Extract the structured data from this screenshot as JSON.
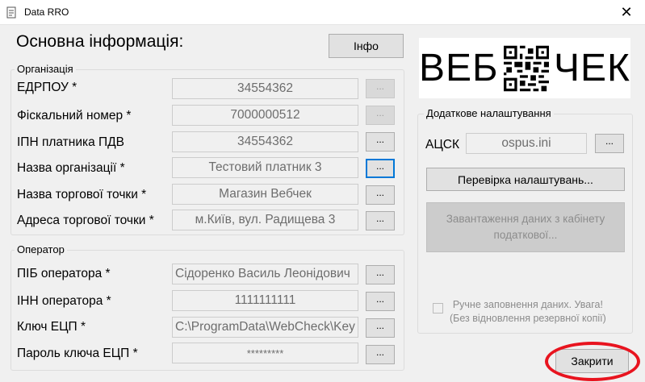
{
  "window": {
    "title": "Data RRO",
    "close_glyph": "✕"
  },
  "heading": "Основна інформація:",
  "info_button": "Інфо",
  "organization": {
    "group_title": "Організація",
    "rows": [
      {
        "label": "ЕДРПОУ *",
        "value": "34554362"
      },
      {
        "label": "Фіскальний номер *",
        "value": "7000000512"
      },
      {
        "label": "ІПН платника ПДВ",
        "value": "34554362"
      },
      {
        "label": "Назва організації *",
        "value": "Тестовий платник 3"
      },
      {
        "label": "Назва торгової точки *",
        "value": "Магазин Вебчек"
      },
      {
        "label": "Адреса торгової точки *",
        "value": "м.Київ, вул. Радищева 3"
      }
    ]
  },
  "operator": {
    "group_title": "Оператор",
    "rows": [
      {
        "label": "ПІБ оператора *",
        "value": "Сідоренко Василь Леонідович"
      },
      {
        "label": "ІНН оператора *",
        "value": "1111111111"
      },
      {
        "label": "Ключ ЕЦП *",
        "value": "C:\\ProgramData\\WebCheck\\Key"
      },
      {
        "label": "Пароль ключа ЕЦП *",
        "value": "*********"
      }
    ]
  },
  "browse_label": "...",
  "logo": {
    "left": "ВЕБ",
    "right": "ЧЕК",
    "icon": "qr-code-icon"
  },
  "additional": {
    "group_title": "Додаткове налаштування",
    "acsk_label": "АЦСК",
    "acsk_value": "ospus.ini",
    "check_settings_button": "Перевірка налаштувань...",
    "load_data_button_line1": "Завантаження даних з кабінету",
    "load_data_button_line2": "податкової...",
    "manual_line1": "Ручне заповнення даних. Увага!",
    "manual_line2": "(Без відновлення резервної копії)",
    "manual_checked": false
  },
  "close_button": "Закрити",
  "colors": {
    "highlight": "#e8141f",
    "focus": "#0078d7"
  }
}
